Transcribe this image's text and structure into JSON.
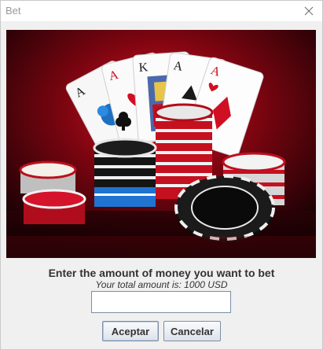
{
  "window": {
    "title": "Bet"
  },
  "banner": {
    "description_icon": "poker-cards-chips-image"
  },
  "prompt": {
    "heading": "Enter the amount of money you want to bet",
    "subtitle": "Your total amount is: 1000 USD"
  },
  "amount_input": {
    "value": "",
    "placeholder": ""
  },
  "buttons": {
    "accept_label": "Aceptar",
    "cancel_label": "Cancelar"
  },
  "colors": {
    "accent_red": "#d8102a",
    "button_border": "#7c8fa6"
  }
}
